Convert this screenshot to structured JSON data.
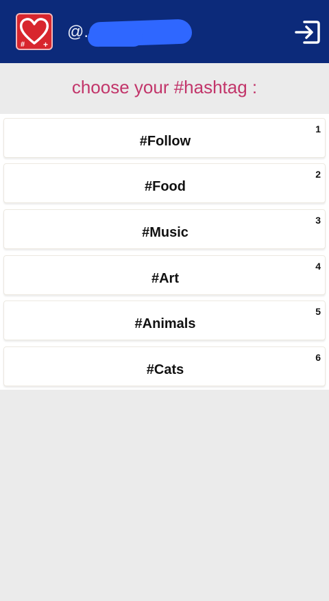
{
  "header": {
    "username": "@.",
    "logo_icon": "heart-hashtag-plus-icon",
    "logout_icon": "logout-icon",
    "bg_color": "#0c2a7a",
    "logo_color": "#d8262d"
  },
  "subtitle": "choose your #hashtag :",
  "hashtags": [
    {
      "number": "1",
      "label": "#Follow"
    },
    {
      "number": "2",
      "label": "#Food"
    },
    {
      "number": "3",
      "label": "#Music"
    },
    {
      "number": "4",
      "label": "#Art"
    },
    {
      "number": "5",
      "label": "#Animals"
    },
    {
      "number": "6",
      "label": "#Cats"
    }
  ],
  "logo_text": {
    "hash": "#",
    "plus": "+"
  }
}
